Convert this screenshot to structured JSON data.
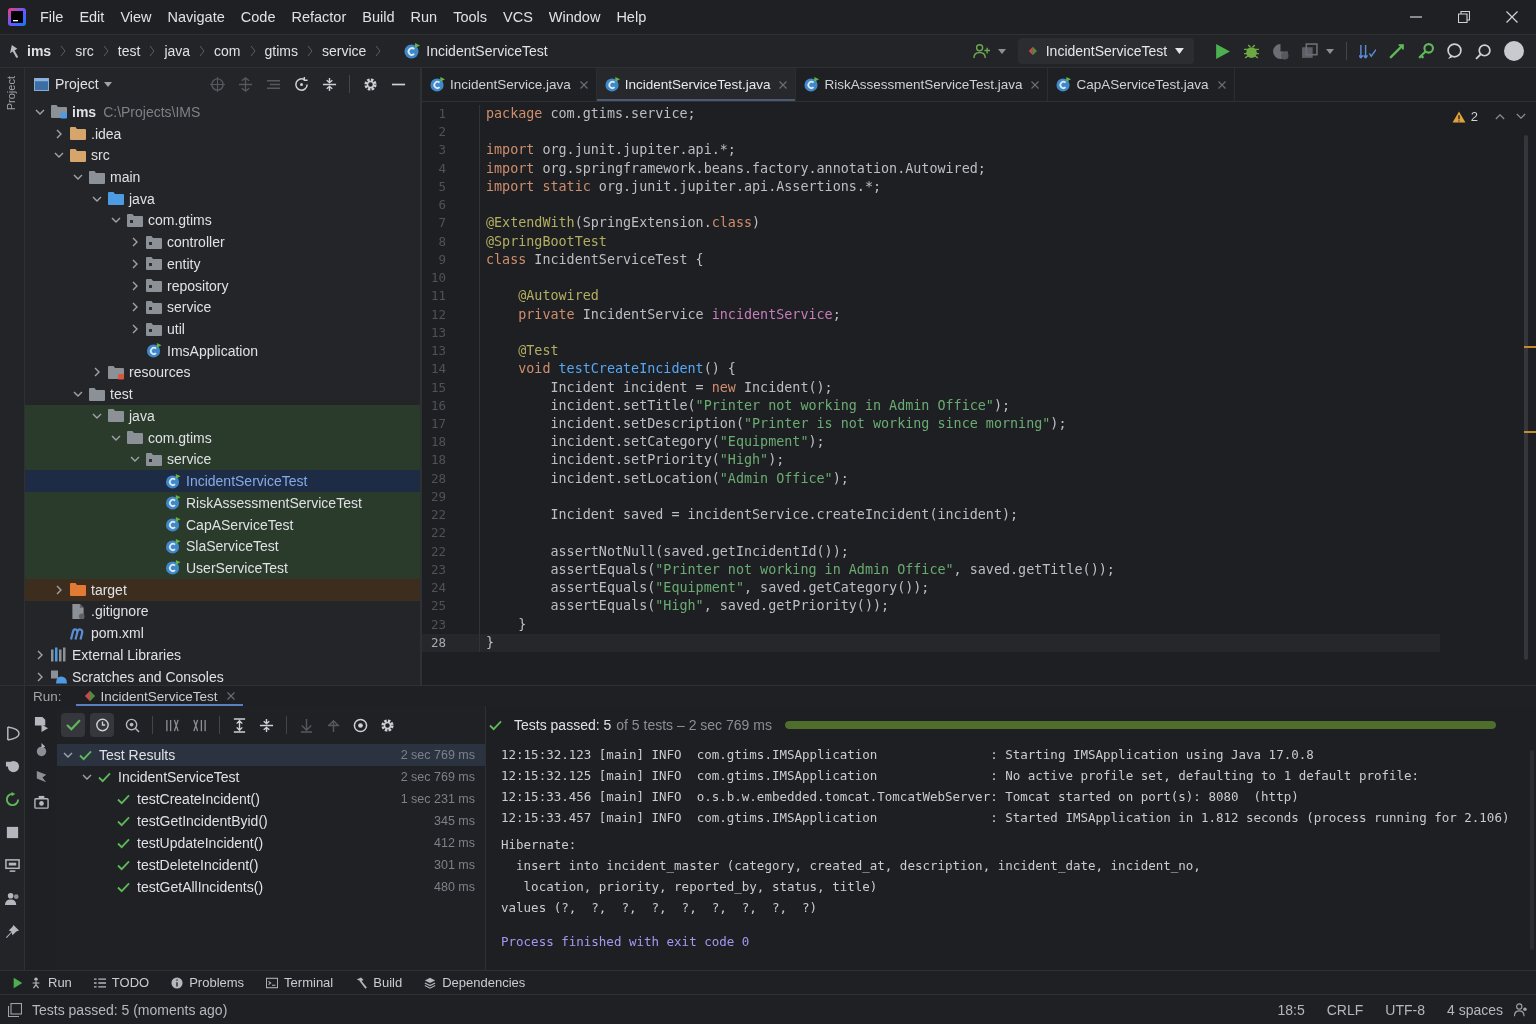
{
  "menu_bar": [
    "File",
    "Edit",
    "View",
    "Navigate",
    "Code",
    "Refactor",
    "Build",
    "Run",
    "Tools",
    "VCS",
    "Window",
    "Help"
  ],
  "navigation_bar": {
    "breadcrumbs": [
      {
        "label": "ims",
        "kind": "module"
      },
      {
        "label": "src",
        "kind": "folder"
      },
      {
        "label": "test",
        "kind": "folder"
      },
      {
        "label": "java",
        "kind": "folder"
      },
      {
        "label": "com",
        "kind": "folder"
      },
      {
        "label": "gtims",
        "kind": "folder"
      },
      {
        "label": "service",
        "kind": "folder"
      },
      {
        "label": "IncidentServiceTest",
        "kind": "class"
      }
    ],
    "run_configuration": "IncidentServiceTest"
  },
  "left_strip": {
    "label": "Project"
  },
  "project_panel": {
    "title": "Project",
    "tree": [
      {
        "label": "ims",
        "path": "C:\\Projects\\IMS",
        "kind": "module",
        "expanded": true,
        "selected": false,
        "children": [
          {
            "label": ".idea",
            "kind": "marked-folder",
            "expanded": false,
            "selected": false,
            "excluded": false
          },
          {
            "label": "src",
            "kind": "marked-folder",
            "expanded": true,
            "selected": false,
            "excluded": false,
            "children": [
              {
                "label": "main",
                "kind": "folder",
                "expanded": true,
                "selected": false,
                "children": [
                  {
                    "label": "java",
                    "kind": "source-root",
                    "expanded": true,
                    "selected": false,
                    "children": [
                      {
                        "label": "com.gtims",
                        "kind": "package",
                        "expanded": true,
                        "selected": false,
                        "children": [
                          {
                            "label": "controller",
                            "kind": "package",
                            "expanded": false,
                            "selected": false
                          },
                          {
                            "label": "entity",
                            "kind": "package",
                            "expanded": false,
                            "selected": false
                          },
                          {
                            "label": "repository",
                            "kind": "package",
                            "expanded": false,
                            "selected": false
                          },
                          {
                            "label": "service",
                            "kind": "package",
                            "expanded": false,
                            "selected": false
                          },
                          {
                            "label": "util",
                            "kind": "package",
                            "expanded": false,
                            "selected": false
                          },
                          {
                            "label": "ImsApplication",
                            "kind": "class",
                            "selected": false
                          }
                        ]
                      }
                    ]
                  },
                  {
                    "label": "resources",
                    "kind": "resources-root",
                    "expanded": false,
                    "selected": false
                  }
                ]
              },
              {
                "label": "test",
                "kind": "folder",
                "expanded": true,
                "selected": false,
                "children": [
                  {
                    "label": "java",
                    "kind": "folder",
                    "expanded": true,
                    "selected": false,
                    "test_source": true,
                    "children": [
                      {
                        "label": "com.gtims",
                        "kind": "folder",
                        "expanded": true,
                        "selected": false,
                        "test_source": true,
                        "children": [
                          {
                            "label": "service",
                            "kind": "package",
                            "expanded": true,
                            "selected": false,
                            "test_source": true,
                            "children": [
                              {
                                "label": "IncidentServiceTest",
                                "kind": "class",
                                "selected": true,
                                "test_source": true
                              },
                              {
                                "label": "RiskAssessmentServiceTest",
                                "kind": "class",
                                "selected": false,
                                "test_source": true
                              },
                              {
                                "label": "CapAServiceTest",
                                "kind": "class",
                                "selected": false,
                                "test_source": true
                              },
                              {
                                "label": "SlaServiceTest",
                                "kind": "class",
                                "selected": false,
                                "test_source": true
                              },
                              {
                                "label": "UserServiceTest",
                                "kind": "class",
                                "selected": false,
                                "test_source": true
                              }
                            ]
                          }
                        ]
                      }
                    ]
                  }
                ]
              }
            ]
          },
          {
            "label": "target",
            "kind": "excluded-folder",
            "expanded": false,
            "selected": false,
            "excluded": true
          },
          {
            "label": ".gitignore",
            "kind": "gitignore",
            "selected": false,
            "excluded": false
          },
          {
            "label": "pom.xml",
            "kind": "maven",
            "selected": false,
            "excluded": false
          }
        ]
      },
      {
        "label": "External Libraries",
        "kind": "libraries",
        "expanded": false,
        "selected": false
      },
      {
        "label": "Scratches and Consoles",
        "kind": "scratches",
        "expanded": false,
        "selected": false
      }
    ]
  },
  "editor": {
    "tabs": [
      {
        "label": "IncidentService.java",
        "selected": false
      },
      {
        "label": "IncidentServiceTest.java",
        "selected": true
      },
      {
        "label": "RiskAssessmentServiceTest.java",
        "selected": false
      },
      {
        "label": "CapAServiceTest.java",
        "selected": false
      }
    ],
    "warnings": "2",
    "lines": [
      {
        "number": "1",
        "current": false,
        "tokens": [
          {
            "kind": "keyword",
            "text": "package"
          },
          {
            "kind": "plain",
            "text": " com.gtims.service;"
          }
        ]
      },
      {
        "number": "2",
        "current": false
      },
      {
        "number": "3",
        "current": false,
        "tokens": [
          {
            "kind": "keyword",
            "text": "import"
          },
          {
            "kind": "plain",
            "text": " org.junit.jupiter.api.*;"
          }
        ]
      },
      {
        "number": "4",
        "current": false,
        "tokens": [
          {
            "kind": "keyword",
            "text": "import"
          },
          {
            "kind": "plain",
            "text": " org.springframework.beans.factory.annotation.Autowired;"
          }
        ]
      },
      {
        "number": "5",
        "current": false,
        "tokens": [
          {
            "kind": "keyword",
            "text": "import static"
          },
          {
            "kind": "plain",
            "text": " org.junit.jupiter.api.Assertions.*;"
          }
        ]
      },
      {
        "number": "6",
        "current": false
      },
      {
        "number": "7",
        "current": false,
        "tokens": [
          {
            "kind": "annotation",
            "text": "@ExtendWith"
          },
          {
            "kind": "plain",
            "text": "(SpringExtension."
          },
          {
            "kind": "keyword",
            "text": "class"
          },
          {
            "kind": "plain",
            "text": ")"
          }
        ]
      },
      {
        "number": "8",
        "current": false,
        "tokens": [
          {
            "kind": "annotation",
            "text": "@SpringBootTest"
          }
        ]
      },
      {
        "number": "9",
        "current": false,
        "tokens": [
          {
            "kind": "keyword",
            "text": "class"
          },
          {
            "kind": "plain",
            "text": " IncidentServiceTest {"
          }
        ]
      },
      {
        "number": "10",
        "current": false
      },
      {
        "number": "11",
        "current": false,
        "tokens": [
          {
            "kind": "annotation",
            "text": "    @Autowired"
          }
        ]
      },
      {
        "number": "12",
        "current": false,
        "tokens": [
          {
            "kind": "keyword",
            "text": "    private"
          },
          {
            "kind": "plain",
            "text": " IncidentService "
          },
          {
            "kind": "field",
            "text": "incidentService"
          },
          {
            "kind": "plain",
            "text": ";"
          }
        ]
      },
      {
        "number": "13",
        "current": false
      },
      {
        "number": "13",
        "current": false,
        "tokens": [
          {
            "kind": "annotation",
            "text": "    @Test"
          }
        ]
      },
      {
        "number": "14",
        "current": false,
        "tokens": [
          {
            "kind": "keyword",
            "text": "    void "
          },
          {
            "kind": "method",
            "text": "testCreateIncident"
          },
          {
            "kind": "plain",
            "text": "() {"
          }
        ]
      },
      {
        "number": "15",
        "current": false,
        "tokens": [
          {
            "kind": "plain",
            "text": "        Incident incident = "
          },
          {
            "kind": "keyword",
            "text": "new"
          },
          {
            "kind": "plain",
            "text": " Incident();"
          }
        ]
      },
      {
        "number": "16",
        "current": false,
        "tokens": [
          {
            "kind": "plain",
            "text": "        incident.setTitle("
          },
          {
            "kind": "string",
            "text": "\"Printer not working in Admin Office\""
          },
          {
            "kind": "plain",
            "text": ");"
          }
        ]
      },
      {
        "number": "17",
        "current": false,
        "tokens": [
          {
            "kind": "plain",
            "text": "        incident.setDescription("
          },
          {
            "kind": "string",
            "text": "\"Printer is not working since morning\""
          },
          {
            "kind": "plain",
            "text": ");"
          }
        ]
      },
      {
        "number": "18",
        "current": false,
        "tokens": [
          {
            "kind": "plain",
            "text": "        incident.setCategory("
          },
          {
            "kind": "string",
            "text": "\"Equipment\""
          },
          {
            "kind": "plain",
            "text": ");"
          }
        ]
      },
      {
        "number": "18",
        "current": false,
        "tokens": [
          {
            "kind": "plain",
            "text": "        incident.setPriority("
          },
          {
            "kind": "string",
            "text": "\"High\""
          },
          {
            "kind": "plain",
            "text": ");"
          }
        ]
      },
      {
        "number": "28",
        "current": false,
        "tokens": [
          {
            "kind": "plain",
            "text": "        incident.setLocation("
          },
          {
            "kind": "string",
            "text": "\"Admin Office\""
          },
          {
            "kind": "plain",
            "text": ");"
          }
        ]
      },
      {
        "number": "29",
        "current": false
      },
      {
        "number": "22",
        "current": false,
        "tokens": [
          {
            "kind": "plain",
            "text": "        Incident saved = incidentService.createIncident(incident);"
          }
        ]
      },
      {
        "number": "22",
        "current": false
      },
      {
        "number": "22",
        "current": false,
        "tokens": [
          {
            "kind": "plain",
            "text": "        assertNotNull(saved.getIncidentId());"
          }
        ]
      },
      {
        "number": "23",
        "current": false,
        "tokens": [
          {
            "kind": "plain",
            "text": "        assertEquals("
          },
          {
            "kind": "string",
            "text": "\"Printer not working in Admin Office\""
          },
          {
            "kind": "plain",
            "text": ", saved.getTitle());"
          }
        ]
      },
      {
        "number": "24",
        "current": false,
        "tokens": [
          {
            "kind": "plain",
            "text": "        assertEquals("
          },
          {
            "kind": "string",
            "text": "\"Equipment\""
          },
          {
            "kind": "plain",
            "text": ", saved.getCategory());"
          }
        ]
      },
      {
        "number": "25",
        "current": false,
        "tokens": [
          {
            "kind": "plain",
            "text": "        assertEquals("
          },
          {
            "kind": "string",
            "text": "\"High\""
          },
          {
            "kind": "plain",
            "text": ", saved.getPriority());"
          }
        ]
      },
      {
        "number": "23",
        "current": false,
        "tokens": [
          {
            "kind": "plain",
            "text": "    }"
          }
        ]
      },
      {
        "number": "28",
        "current": true,
        "tokens": [
          {
            "kind": "plain",
            "text": "}"
          }
        ]
      }
    ]
  },
  "run_panel": {
    "label": "Run:",
    "tabs": [
      {
        "label": "IncidentServiceTest",
        "selected": true
      }
    ],
    "toggles": [
      {
        "kind": "check",
        "on": true
      },
      {
        "kind": "clock",
        "on": true
      }
    ],
    "test_results": [
      {
        "label": "Test Results",
        "time": "2 sec 769 ms",
        "passed": true,
        "expanded": true,
        "selected": true,
        "children": [
          {
            "label": "IncidentServiceTest",
            "time": "2 sec 769 ms",
            "passed": true,
            "expanded": true,
            "selected": false,
            "children": [
              {
                "label": "testCreateIncident()",
                "time": "1 sec 231 ms",
                "passed": true,
                "selected": false
              },
              {
                "label": "testGetIncidentByid()",
                "time": "345 ms",
                "passed": true,
                "selected": false
              },
              {
                "label": "testUpdateIncident()",
                "time": "412 ms",
                "passed": true,
                "selected": false
              },
              {
                "label": "testDeleteIncident()",
                "time": "301 ms",
                "passed": true,
                "selected": false
              },
              {
                "label": "testGetAllIncidents()",
                "time": "480 ms",
                "passed": true,
                "selected": false
              }
            ]
          }
        ]
      }
    ],
    "summary": {
      "status": "Tests passed: 5",
      "detail": "of 5 tests – 2 sec 769 ms",
      "passed": true,
      "level": 1
    },
    "console": [
      {
        "kind": "log",
        "lines": [
          "12:15:32.123 [main] INFO  com.gtims.IMSApplication               : Starting IMSApplication using Java 17.0.8",
          "12:15:32.125 [main] INFO  com.gtims.IMSApplication               : No active profile set, defaulting to 1 default profile:",
          "12:15:33.456 [main] INFO  o.s.b.w.embedded.tomcat.TomcatWebServer: Tomcat started on port(s): 8080  (http)",
          "12:15:33.457 [main] INFO  com.gtims.IMSApplication               : Started IMSApplication in 1.812 seconds (process running for 2.106)"
        ]
      },
      {
        "kind": "sql",
        "lines": [
          "Hibernate:",
          "  insert into incident_master (category, created_at, description, incident_date, incident_no,",
          "   location, priority, reported_by, status, title)",
          "values (?,  ?,  ?,  ?,  ?,  ?,  ?,  ?,  ?)"
        ]
      },
      {
        "kind": "exit",
        "lines": [
          "Process finished with exit code 0"
        ]
      }
    ]
  },
  "tool_windows": [
    {
      "label": "Run",
      "kind": "run"
    },
    {
      "label": "TODO",
      "kind": "todo"
    },
    {
      "label": "Problems",
      "kind": "problems"
    },
    {
      "label": "Terminal",
      "kind": "terminal"
    },
    {
      "label": "Build",
      "kind": "build"
    },
    {
      "label": "Dependencies",
      "kind": "dependencies"
    }
  ],
  "status_bar": {
    "message": "Tests passed: 5 (moments ago)",
    "items": [
      "18:5",
      "CRLF",
      "UTF-8",
      "4 spaces"
    ]
  }
}
